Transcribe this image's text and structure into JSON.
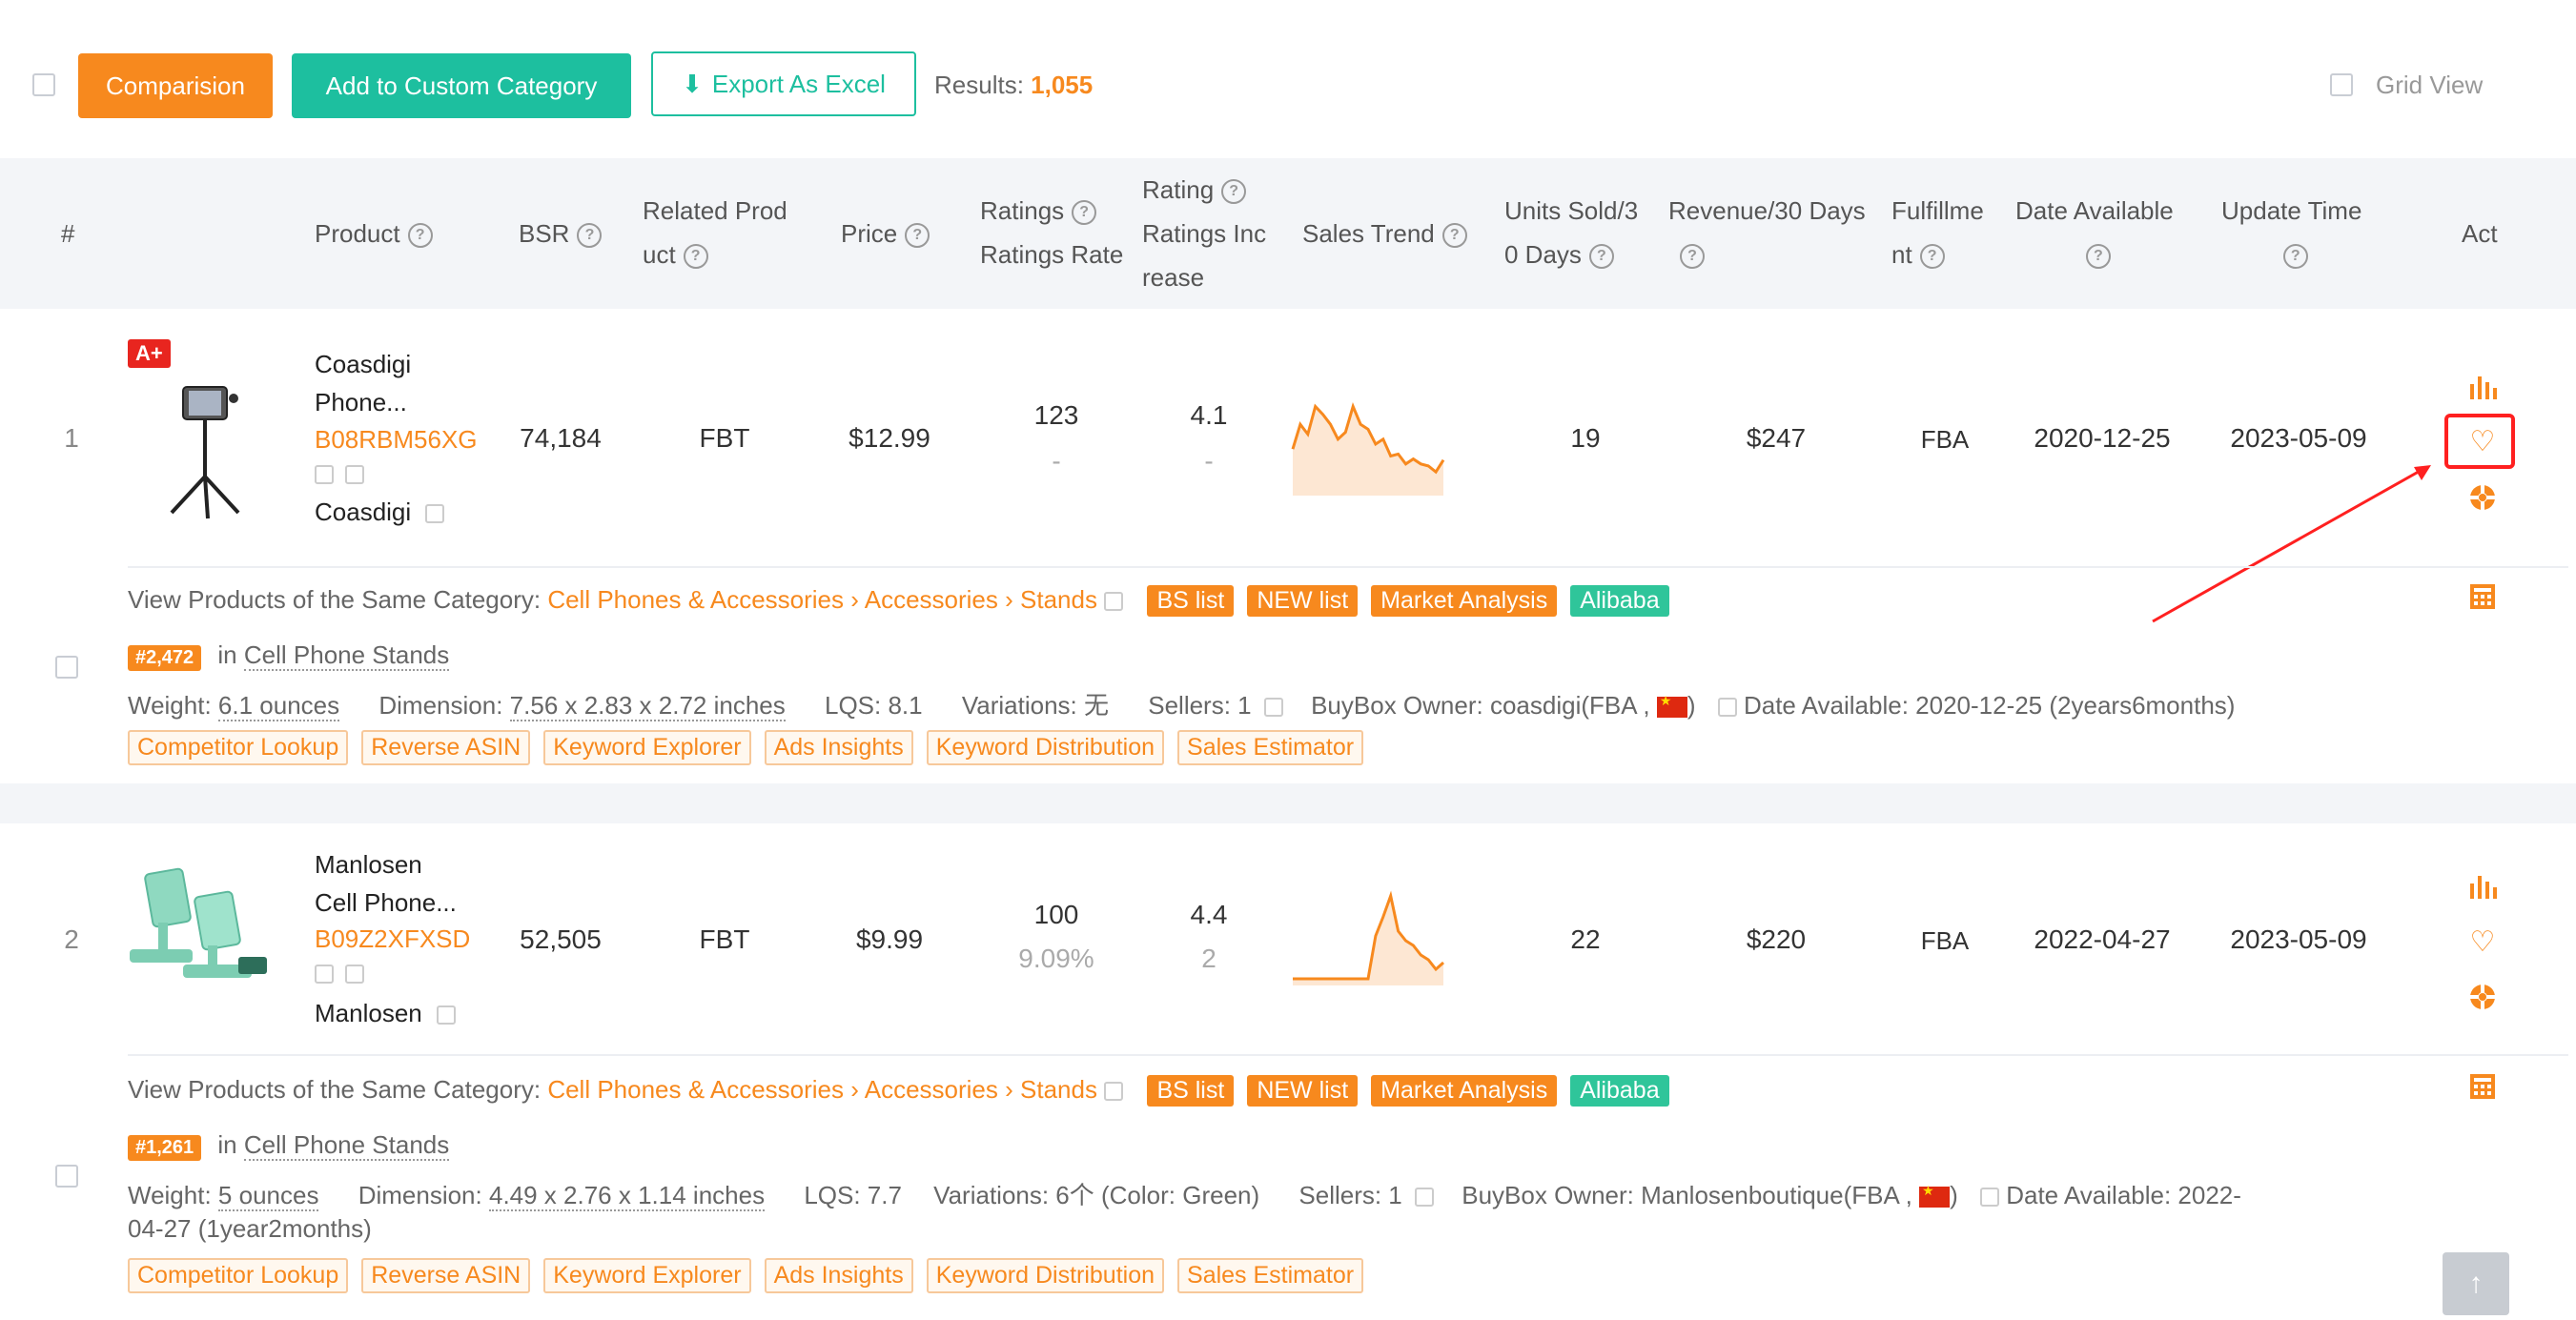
{
  "toolbar": {
    "comparison": "Comparision",
    "add_custom": "Add to Custom Category",
    "export": "Export As Excel",
    "results_label": "Results:",
    "results_count": "1,055",
    "grid_view": "Grid View"
  },
  "columns": {
    "num": "#",
    "product": "Product",
    "bsr": "BSR",
    "related_l1": "Related Prod",
    "related_l2": "uct",
    "price": "Price",
    "ratings_l1": "Ratings",
    "ratings_l2": "Ratings Rate",
    "rating_l1": "Rating",
    "rating_l2": "Ratings Inc",
    "rating_l3": "rease",
    "sales_trend": "Sales Trend",
    "units_l1": "Units Sold/3",
    "units_l2": "0 Days",
    "revenue_l1": "Revenue/30 Days",
    "fulfill_l1": "Fulfillme",
    "fulfill_l2": "nt",
    "date_l1": "Date Available",
    "update_l1": "Update Time",
    "act": "Act"
  },
  "rows": [
    {
      "index": "1",
      "badge": "A+",
      "brand_line": "Coasdigi",
      "name_line": "Phone...",
      "asin": "B08RBM56XG",
      "brand": "Coasdigi",
      "bsr": "74,184",
      "related": "FBT",
      "price": "$12.99",
      "ratings": "123",
      "ratings_rate": "-",
      "rating": "4.1",
      "ratings_inc": "-",
      "units": "19",
      "revenue": "$247",
      "fulfillment": "FBA",
      "date_available": "2020-12-25",
      "update_time": "2023-05-09",
      "trend": [
        0.55,
        0.3,
        0.4,
        0.12,
        0.2,
        0.3,
        0.45,
        0.38,
        0.12,
        0.3,
        0.35,
        0.5,
        0.45,
        0.62,
        0.6,
        0.7,
        0.65,
        0.7,
        0.72,
        0.78,
        0.66
      ],
      "category_label": "View Products of the Same Category:",
      "cat1": "Cell Phones & Accessories",
      "cat2": "Accessories",
      "cat3": "Stands",
      "rank": "#2,472",
      "rank_in": "in",
      "rank_cat": "Cell Phone Stands",
      "weight_label": "Weight:",
      "weight": "6.1 ounces",
      "dim_label": "Dimension:",
      "dim": "7.56 x 2.83 x 2.72 inches",
      "lqs": "LQS: 8.1",
      "variations": "Variations: 无",
      "sellers": "Sellers: 1",
      "buybox": "BuyBox Owner: coasdigi(FBA ,",
      "buybox_end": ")",
      "date_info": "Date Available: 2020-12-25 (2years6months)"
    },
    {
      "index": "2",
      "brand_line": "Manlosen",
      "name_line": "Cell Phone...",
      "asin": "B09Z2XFXSD",
      "brand": "Manlosen",
      "bsr": "52,505",
      "related": "FBT",
      "price": "$9.99",
      "ratings": "100",
      "ratings_rate": "9.09%",
      "rating": "4.4",
      "ratings_inc": "2",
      "units": "22",
      "revenue": "$220",
      "fulfillment": "FBA",
      "date_available": "2022-04-27",
      "update_time": "2023-05-09",
      "trend": [
        0.95,
        0.95,
        0.95,
        0.95,
        0.95,
        0.95,
        0.95,
        0.95,
        0.95,
        0.95,
        0.95,
        0.5,
        0.3,
        0.08,
        0.45,
        0.55,
        0.6,
        0.7,
        0.75,
        0.85,
        0.78
      ],
      "category_label": "View Products of the Same Category:",
      "cat1": "Cell Phones & Accessories",
      "cat2": "Accessories",
      "cat3": "Stands",
      "rank": "#1,261",
      "rank_in": "in",
      "rank_cat": "Cell Phone Stands",
      "weight_label": "Weight:",
      "weight": "5 ounces",
      "dim_label": "Dimension:",
      "dim": "4.49 x 2.76 x 1.14 inches",
      "lqs": "LQS: 7.7",
      "variations": "Variations: 6个 (Color: Green)",
      "sellers": "Sellers: 1",
      "buybox": "BuyBox Owner: Manlosenboutique(FBA ,",
      "buybox_end": ")",
      "date_info_1": "Date Available: 2022-",
      "date_info_2": "04-27 (1year2months)"
    }
  ],
  "tags": {
    "bs": "BS list",
    "new": "NEW list",
    "market": "Market Analysis",
    "alibaba": "Alibaba"
  },
  "tools": [
    "Competitor Lookup",
    "Reverse ASIN",
    "Keyword Explorer",
    "Ads Insights",
    "Keyword Distribution",
    "Sales Estimator"
  ],
  "colors": {
    "accent": "#f7891e",
    "teal": "#1dbf9f",
    "highlight": "#ff2020"
  }
}
